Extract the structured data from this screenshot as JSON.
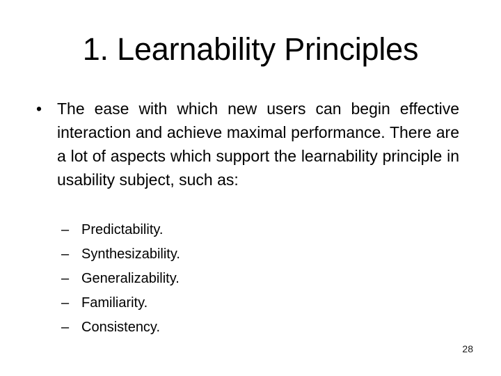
{
  "slide": {
    "title": "1. Learnability Principles",
    "background_color": "#ffffff",
    "text_color": "#000000",
    "page_number": "28"
  },
  "body": {
    "bullet_marker": "•",
    "paragraph": "The ease with which new users can begin effective interaction and achieve maximal performance. There are a lot of aspects which support the learnability principle in usability subject, such as:",
    "sub_marker": "–",
    "sub_items": [
      {
        "label": "Predictability."
      },
      {
        "label": "Synthesizability."
      },
      {
        "label": "Generalizability."
      },
      {
        "label": "Familiarity."
      },
      {
        "label": "Consistency."
      }
    ]
  }
}
